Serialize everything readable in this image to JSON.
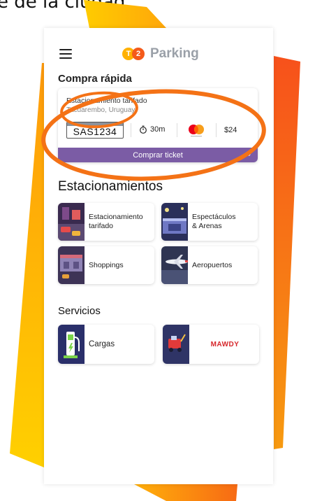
{
  "caption": "e de la ciudad.",
  "app": {
    "brand_t": "T",
    "brand_2": "2",
    "brand_name": "Parking"
  },
  "quick": {
    "title": "Compra rápida",
    "card_title": "Estacionamiento tarifado",
    "card_subtitle": "Tacuarembo, Uruguay",
    "plate": "SAS1234",
    "duration": "30m",
    "price": "$24",
    "buy_label": "Comprar ticket",
    "buy_chevron": "›"
  },
  "parking": {
    "title": "Estacionamientos",
    "items": [
      {
        "label_1": "Estacionamiento",
        "label_2": "tarifado"
      },
      {
        "label_1": "Espectáculos",
        "label_2": "& Arenas"
      },
      {
        "label_1": "Shoppings",
        "label_2": ""
      },
      {
        "label_1": "Aeropuertos",
        "label_2": ""
      }
    ]
  },
  "services": {
    "title": "Servicios",
    "items": [
      {
        "label": "Cargas"
      },
      {
        "label": "MAWDY"
      }
    ]
  },
  "colors": {
    "accent_orange": "#f47216",
    "stripe_yellow": "#ffc400",
    "buy_bar": "#7b5ca5",
    "brand_gray": "#9aa0a8"
  },
  "icons": [
    "hamburger-menu-icon",
    "stopwatch-icon",
    "mastercard-icon",
    "chevron-right-icon",
    "ev-charger-icon"
  ]
}
